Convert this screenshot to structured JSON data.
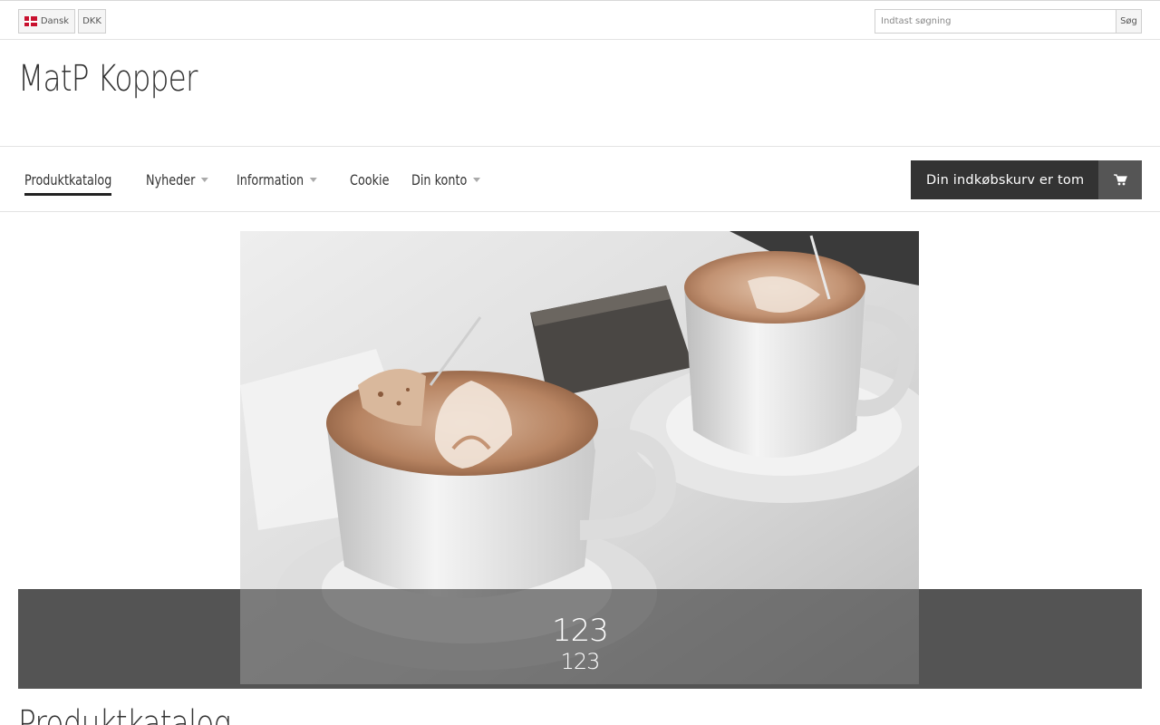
{
  "topbar": {
    "language_label": "Dansk",
    "currency_label": "DKK",
    "search": {
      "placeholder": "Indtast søgning",
      "button_label": "Søg"
    }
  },
  "logo": {
    "text": "MatP Kopper"
  },
  "nav": {
    "items": [
      {
        "label": "Produktkatalog",
        "active": true,
        "has_dropdown": false
      },
      {
        "label": "Nyheder",
        "active": false,
        "has_dropdown": true
      },
      {
        "label": "Information",
        "active": false,
        "has_dropdown": true
      },
      {
        "label": "Cookie",
        "active": false,
        "has_dropdown": false
      },
      {
        "label": "Din konto",
        "active": false,
        "has_dropdown": true
      }
    ],
    "cart_label": "Din indkøbskurv er tom",
    "cart_icon": "shopping-cart-icon"
  },
  "hero": {
    "caption_title": "123",
    "caption_subtitle": "123",
    "image_subject": "two cups of latte on saucers"
  },
  "main": {
    "section_title": "Produktkatalog"
  },
  "colors": {
    "dark": "#333333",
    "accent": "#555555"
  }
}
